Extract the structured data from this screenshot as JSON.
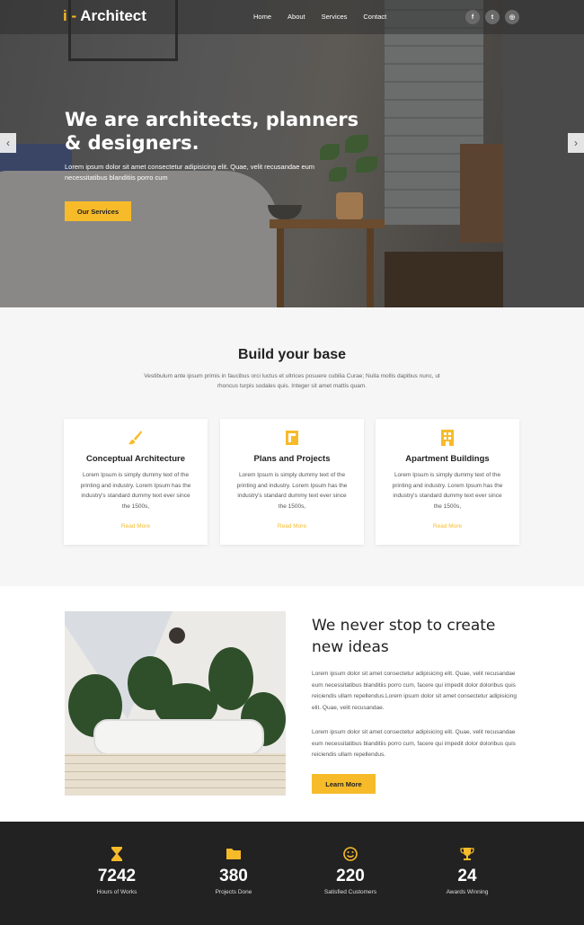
{
  "nav": {
    "logo_mark": "i -",
    "logo_text": "Architect",
    "menu": [
      "Home",
      "About",
      "Services",
      "Contact"
    ],
    "socials": [
      {
        "icon": "facebook-icon",
        "glyph": "f"
      },
      {
        "icon": "twitter-icon",
        "glyph": "t"
      },
      {
        "icon": "instagram-icon",
        "glyph": "◎"
      }
    ]
  },
  "hero": {
    "title": "We are architects, planners & designers.",
    "subtitle": "Lorem ipsum dolor sit amet consectetur adipisicing elit. Quae, velit recusandae eum necessitatibus blanditiis porro cum",
    "button": "Our Services",
    "prev": "‹",
    "next": "›"
  },
  "build": {
    "title": "Build your base",
    "subtitle": "Vestibulum ante ipsum primis in faucibus orci luctus et ultrices posuere cubilia Curae; Nulla mollis dapibus nunc, ut rhoncus turpis sodales quis. Integer sit amet mattis quam.",
    "cards": [
      {
        "icon": "brush-icon",
        "title": "Conceptual Architecture",
        "text": "Lorem Ipsum is simply dummy text of the printing and industry. Lorem Ipsum has the industry's standard dummy text ever since the 1500s,",
        "link": "Read More"
      },
      {
        "icon": "blueprint-icon",
        "title": "Plans and Projects",
        "text": "Lorem Ipsum is simply dummy text of the printing and industry. Lorem Ipsum has the industry's standard dummy text ever since the 1500s,",
        "link": "Read More"
      },
      {
        "icon": "building-icon",
        "title": "Apartment Buildings",
        "text": "Lorem Ipsum is simply dummy text of the printing and industry. Lorem Ipsum has the industry's standard dummy text ever since the 1500s,",
        "link": "Read More"
      }
    ]
  },
  "ideas": {
    "title": "We never stop to create new ideas",
    "p1": "Lorem ipsum dolor sit amet consectetur adipisicing elit. Quae, velit recusandae eum necessitatibus blanditiis porro cum, facere qui impedit dolor doloribus quis reiciendis ullam repellendus.Lorem ipsum dolor sit amet consectetur adipisicing elit. Quae, velit recusandae.",
    "p2": "Lorem ipsum dolor sit amet consectetur adipisicing elit. Quae, velit recusandae eum necessitatibus blanditiis porro cum, facere qui impedit dolor doloribus quis reiciendis ullam repellendus.",
    "button": "Learn More"
  },
  "stats": [
    {
      "icon": "hourglass-icon",
      "number": "7242",
      "label": "Hours of Works"
    },
    {
      "icon": "folder-icon",
      "number": "380",
      "label": "Projects Done"
    },
    {
      "icon": "smile-icon",
      "number": "220",
      "label": "Satisfied Customers"
    },
    {
      "icon": "trophy-icon",
      "number": "24",
      "label": "Awards Winning"
    }
  ],
  "colors": {
    "accent": "#f7bb2a",
    "dark": "#222222"
  }
}
